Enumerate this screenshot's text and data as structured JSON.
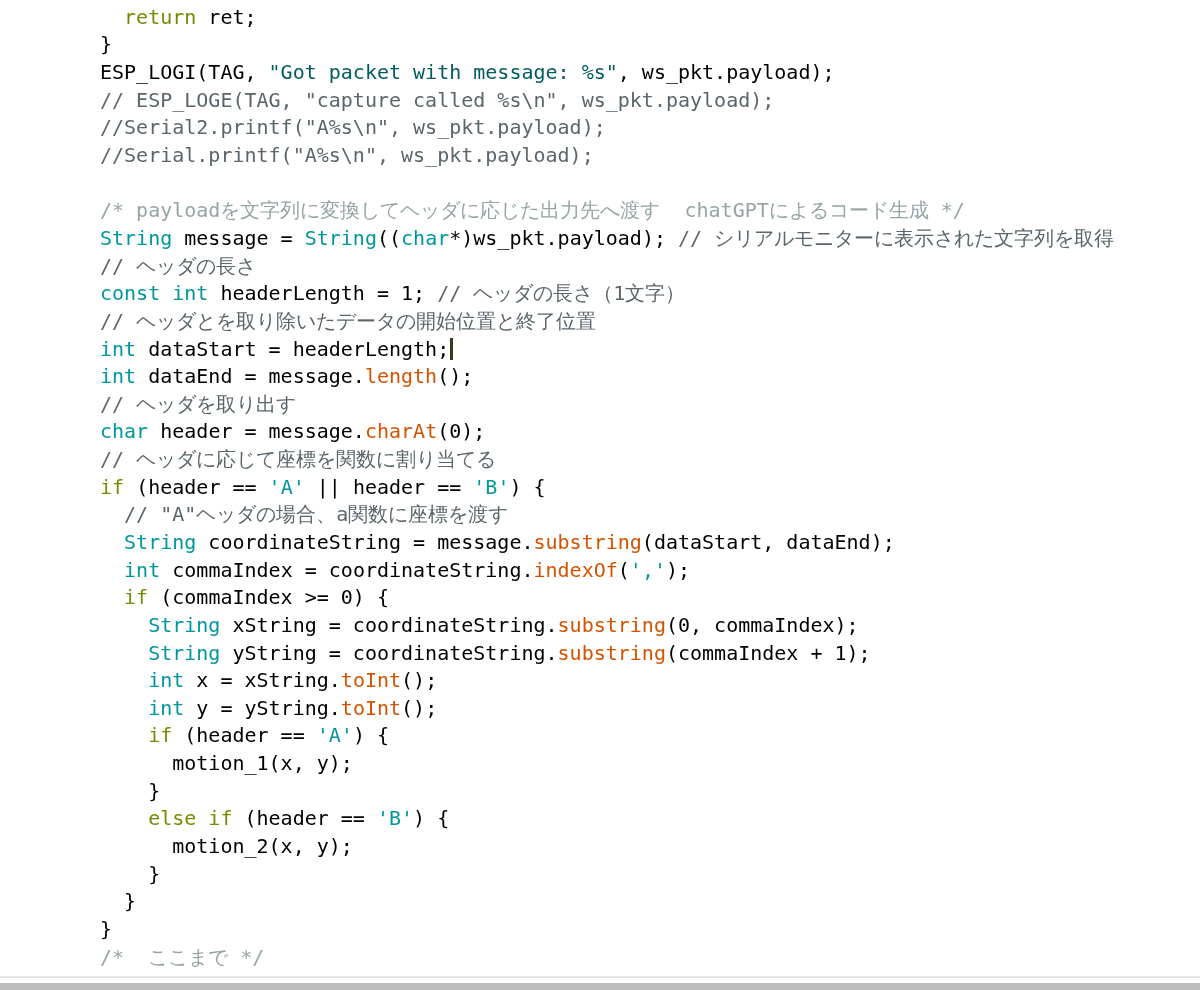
{
  "editor": {
    "lines": [
      {
        "kind": "code",
        "cursor": false,
        "tokens": [
          {
            "text": "  return",
            "kind": "keyword"
          },
          {
            "text": " ret;",
            "kind": "plain"
          }
        ]
      },
      {
        "kind": "code",
        "cursor": false,
        "tokens": [
          {
            "text": "}",
            "kind": "plain"
          }
        ]
      },
      {
        "kind": "code",
        "cursor": false,
        "tokens": [
          {
            "text": "ESP_LOGI(TAG, ",
            "kind": "plain"
          },
          {
            "text": "\"Got packet with message: %s\"",
            "kind": "string"
          },
          {
            "text": ", ws_pkt.payload);",
            "kind": "plain"
          }
        ]
      },
      {
        "kind": "code",
        "cursor": false,
        "tokens": [
          {
            "text": "// ESP_LOGE(TAG, \"capture called %s\\n\", ws_pkt.payload);",
            "kind": "comment"
          }
        ]
      },
      {
        "kind": "code",
        "cursor": false,
        "tokens": [
          {
            "text": "//Serial2.printf(\"A%s\\n\", ws_pkt.payload);",
            "kind": "comment"
          }
        ]
      },
      {
        "kind": "code",
        "cursor": false,
        "tokens": [
          {
            "text": "//Serial.printf(\"A%s\\n\", ws_pkt.payload);",
            "kind": "comment"
          }
        ]
      },
      {
        "kind": "blank"
      },
      {
        "kind": "code",
        "cursor": false,
        "tokens": [
          {
            "text": "/* payloadを文字列に変換してヘッダに応じた出力先へ渡す  chatGPTによるコード生成 */",
            "kind": "block-comment"
          }
        ]
      },
      {
        "kind": "code",
        "cursor": false,
        "tokens": [
          {
            "text": "String",
            "kind": "type"
          },
          {
            "text": " message = ",
            "kind": "plain"
          },
          {
            "text": "String",
            "kind": "type"
          },
          {
            "text": "((",
            "kind": "plain"
          },
          {
            "text": "char",
            "kind": "type"
          },
          {
            "text": "*)ws_pkt.payload); ",
            "kind": "plain"
          },
          {
            "text": "// シリアルモニターに表示された文字列を取得",
            "kind": "comment"
          }
        ]
      },
      {
        "kind": "code",
        "cursor": false,
        "tokens": [
          {
            "text": "// ヘッダの長さ",
            "kind": "comment"
          }
        ]
      },
      {
        "kind": "code",
        "cursor": false,
        "tokens": [
          {
            "text": "const int",
            "kind": "type"
          },
          {
            "text": " headerLength = 1; ",
            "kind": "plain"
          },
          {
            "text": "// ヘッダの長さ（1文字）",
            "kind": "comment"
          }
        ]
      },
      {
        "kind": "code",
        "cursor": false,
        "tokens": [
          {
            "text": "// ヘッダとを取り除いたデータの開始位置と終了位置",
            "kind": "comment"
          }
        ]
      },
      {
        "kind": "code",
        "cursor": true,
        "tokens": [
          {
            "text": "int",
            "kind": "type"
          },
          {
            "text": " dataStart = headerLength;",
            "kind": "plain"
          }
        ]
      },
      {
        "kind": "code",
        "cursor": false,
        "tokens": [
          {
            "text": "int",
            "kind": "type"
          },
          {
            "text": " dataEnd = message.",
            "kind": "plain"
          },
          {
            "text": "length",
            "kind": "function"
          },
          {
            "text": "();",
            "kind": "plain"
          }
        ]
      },
      {
        "kind": "code",
        "cursor": false,
        "tokens": [
          {
            "text": "// ヘッダを取り出す",
            "kind": "comment"
          }
        ]
      },
      {
        "kind": "code",
        "cursor": false,
        "tokens": [
          {
            "text": "char",
            "kind": "type"
          },
          {
            "text": " header = message.",
            "kind": "plain"
          },
          {
            "text": "charAt",
            "kind": "function"
          },
          {
            "text": "(0);",
            "kind": "plain"
          }
        ]
      },
      {
        "kind": "code",
        "cursor": false,
        "tokens": [
          {
            "text": "// ヘッダに応じて座標を関数に割り当てる",
            "kind": "comment"
          }
        ]
      },
      {
        "kind": "code",
        "cursor": false,
        "tokens": [
          {
            "text": "if",
            "kind": "keyword"
          },
          {
            "text": " (header == ",
            "kind": "plain"
          },
          {
            "text": "'A'",
            "kind": "char"
          },
          {
            "text": " || header == ",
            "kind": "plain"
          },
          {
            "text": "'B'",
            "kind": "char"
          },
          {
            "text": ") {",
            "kind": "plain"
          }
        ]
      },
      {
        "kind": "code",
        "cursor": false,
        "tokens": [
          {
            "text": "  // \"A\"ヘッダの場合、a関数に座標を渡す",
            "kind": "comment"
          }
        ]
      },
      {
        "kind": "code",
        "cursor": false,
        "tokens": [
          {
            "text": "  String",
            "kind": "type"
          },
          {
            "text": " coordinateString = message.",
            "kind": "plain"
          },
          {
            "text": "substring",
            "kind": "function"
          },
          {
            "text": "(dataStart, dataEnd);",
            "kind": "plain"
          }
        ]
      },
      {
        "kind": "code",
        "cursor": false,
        "tokens": [
          {
            "text": "  int",
            "kind": "type"
          },
          {
            "text": " commaIndex = coordinateString.",
            "kind": "plain"
          },
          {
            "text": "indexOf",
            "kind": "function"
          },
          {
            "text": "(",
            "kind": "plain"
          },
          {
            "text": "','",
            "kind": "char"
          },
          {
            "text": ");",
            "kind": "plain"
          }
        ]
      },
      {
        "kind": "code",
        "cursor": false,
        "tokens": [
          {
            "text": "  if",
            "kind": "keyword"
          },
          {
            "text": " (commaIndex >= 0) {",
            "kind": "plain"
          }
        ]
      },
      {
        "kind": "code",
        "cursor": false,
        "tokens": [
          {
            "text": "    String",
            "kind": "type"
          },
          {
            "text": " xString = coordinateString.",
            "kind": "plain"
          },
          {
            "text": "substring",
            "kind": "function"
          },
          {
            "text": "(0, commaIndex);",
            "kind": "plain"
          }
        ]
      },
      {
        "kind": "code",
        "cursor": false,
        "tokens": [
          {
            "text": "    String",
            "kind": "type"
          },
          {
            "text": " yString = coordinateString.",
            "kind": "plain"
          },
          {
            "text": "substring",
            "kind": "function"
          },
          {
            "text": "(commaIndex + 1);",
            "kind": "plain"
          }
        ]
      },
      {
        "kind": "code",
        "cursor": false,
        "tokens": [
          {
            "text": "    int",
            "kind": "type"
          },
          {
            "text": " x = xString.",
            "kind": "plain"
          },
          {
            "text": "toInt",
            "kind": "function"
          },
          {
            "text": "();",
            "kind": "plain"
          }
        ]
      },
      {
        "kind": "code",
        "cursor": false,
        "tokens": [
          {
            "text": "    int",
            "kind": "type"
          },
          {
            "text": " y = yString.",
            "kind": "plain"
          },
          {
            "text": "toInt",
            "kind": "function"
          },
          {
            "text": "();",
            "kind": "plain"
          }
        ]
      },
      {
        "kind": "code",
        "cursor": false,
        "tokens": [
          {
            "text": "    if",
            "kind": "keyword"
          },
          {
            "text": " (header == ",
            "kind": "plain"
          },
          {
            "text": "'A'",
            "kind": "char"
          },
          {
            "text": ") {",
            "kind": "plain"
          }
        ]
      },
      {
        "kind": "code",
        "cursor": false,
        "tokens": [
          {
            "text": "      motion_1(x, y);",
            "kind": "plain"
          }
        ]
      },
      {
        "kind": "code",
        "cursor": false,
        "tokens": [
          {
            "text": "    }",
            "kind": "plain"
          }
        ]
      },
      {
        "kind": "code",
        "cursor": false,
        "tokens": [
          {
            "text": "    else if",
            "kind": "keyword"
          },
          {
            "text": " (header == ",
            "kind": "plain"
          },
          {
            "text": "'B'",
            "kind": "char"
          },
          {
            "text": ") {",
            "kind": "plain"
          }
        ]
      },
      {
        "kind": "code",
        "cursor": false,
        "tokens": [
          {
            "text": "      motion_2(x, y);",
            "kind": "plain"
          }
        ]
      },
      {
        "kind": "code",
        "cursor": false,
        "tokens": [
          {
            "text": "    }",
            "kind": "plain"
          }
        ]
      },
      {
        "kind": "code",
        "cursor": false,
        "tokens": [
          {
            "text": "  }",
            "kind": "plain"
          }
        ]
      },
      {
        "kind": "code",
        "cursor": false,
        "tokens": [
          {
            "text": "}",
            "kind": "plain"
          }
        ]
      },
      {
        "kind": "code",
        "cursor": false,
        "tokens": [
          {
            "text": "/*  ここまで */",
            "kind": "block-comment"
          }
        ]
      }
    ]
  }
}
